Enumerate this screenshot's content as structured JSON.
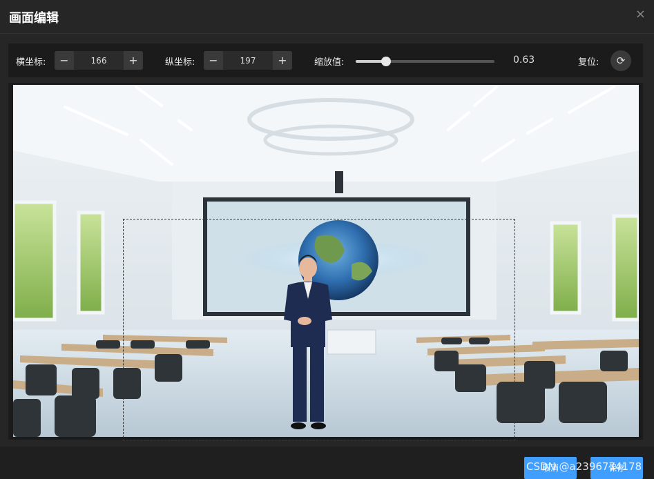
{
  "dialog": {
    "title": "画面编辑"
  },
  "toolbar": {
    "x_label": "横坐标:",
    "x_value": "166",
    "y_label": "纵坐标:",
    "y_value": "197",
    "scale_label": "缩放值:",
    "scale_value": "0.63",
    "scale_fraction": 0.22,
    "reset_label": "复位:"
  },
  "icons": {
    "minus": "−",
    "plus": "+",
    "close": "×",
    "reset": "⟳"
  },
  "footer": {
    "cancel_label": "取消",
    "save_label": "保存"
  },
  "watermark": {
    "text": "CSDN @a2396774178"
  }
}
